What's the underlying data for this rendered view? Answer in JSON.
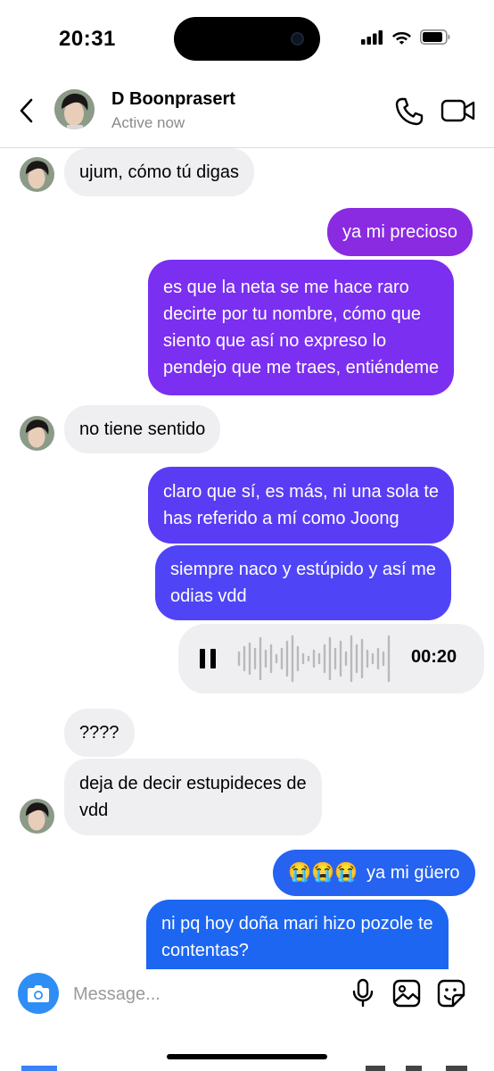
{
  "status_bar": {
    "time": "20:31"
  },
  "header": {
    "name": "D Boonprasert",
    "status": "Active now"
  },
  "messages": [
    {
      "direction": "in",
      "text": "ujum, cómo tú digas"
    },
    {
      "direction": "out",
      "text": "ya mi precioso",
      "color": "#8a2be2"
    },
    {
      "direction": "out",
      "lines": [
        "es que la neta se me hace raro",
        "decirte por tu nombre, cómo que",
        "siento que así no expreso lo",
        "pendejo que me traes, entiéndeme"
      ],
      "color": "#7b2ff0"
    },
    {
      "direction": "in",
      "text": "no tiene sentido"
    },
    {
      "direction": "out",
      "lines": [
        "claro que sí, es más, ni una sola te",
        "has referido a mí como Joong"
      ],
      "color": "#5b3cf5"
    },
    {
      "direction": "out",
      "lines": [
        "siempre naco y estúpido y así me",
        "odias vdd"
      ],
      "color": "#4f45f6"
    },
    {
      "direction": "out",
      "type": "voice",
      "duration": "00:20"
    },
    {
      "direction": "in",
      "text": "????"
    },
    {
      "direction": "in",
      "lines": [
        "deja de decir estupideces de",
        "vdd"
      ]
    },
    {
      "direction": "out",
      "emoji": "😭😭😭",
      "text": "ya mi güero",
      "color": "#2563f0"
    },
    {
      "direction": "out",
      "lines": [
        "ni pq hoy doña mari hizo pozole te",
        "contentas?"
      ],
      "color": "#1d66f2"
    }
  ],
  "composer": {
    "placeholder": "Message..."
  },
  "colors": {
    "incoming_bubble": "#efeff1",
    "camera_button": "#2f8ef5"
  },
  "icons": [
    "back-chevron-icon",
    "phone-icon",
    "video-camera-icon",
    "camera-icon",
    "microphone-icon",
    "image-icon",
    "sticker-icon",
    "pause-icon",
    "waveform-icon",
    "signal-icon",
    "wifi-icon",
    "battery-icon"
  ]
}
